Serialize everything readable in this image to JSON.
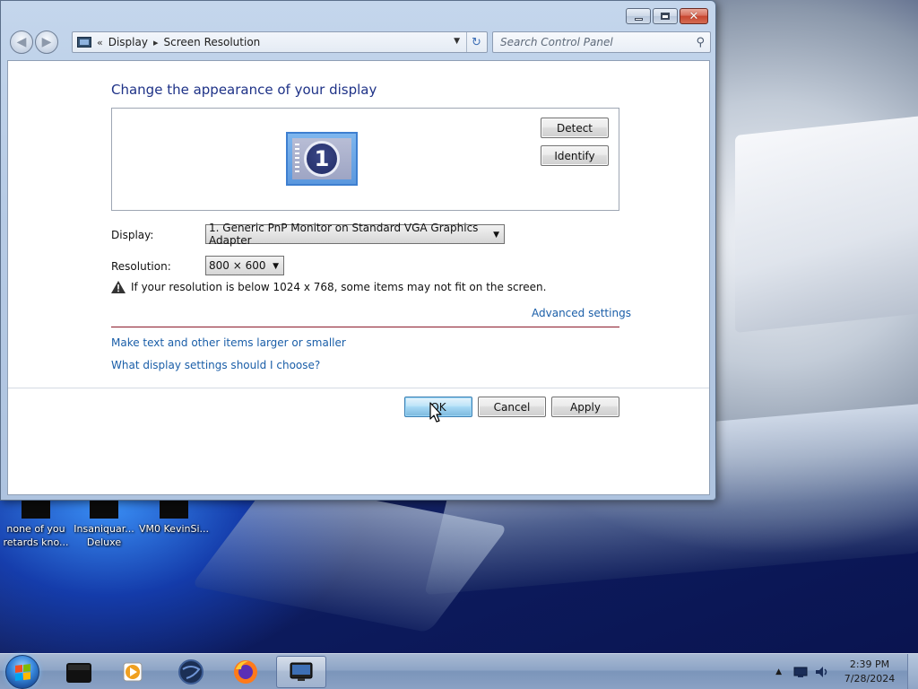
{
  "window": {
    "breadcrumb": [
      "Display",
      "Screen Resolution"
    ],
    "breadcrumb_back": "«",
    "search_placeholder": "Search Control Panel",
    "heading": "Change the appearance of your display",
    "detect_label": "Detect",
    "identify_label": "Identify",
    "monitor_number": "1",
    "display_label": "Display:",
    "display_value": "1. Generic PnP Monitor on Standard VGA Graphics Adapter",
    "resolution_label": "Resolution:",
    "resolution_value": "800 × 600",
    "warning_text": "If your resolution is below 1024 x 768, some items may not fit on the screen.",
    "advanced_settings_link": "Advanced settings",
    "link_text_size": "Make text and other items larger or smaller",
    "link_help": "What display settings should I choose?",
    "ok_label": "OK",
    "cancel_label": "Cancel",
    "apply_label": "Apply"
  },
  "desktop_icons": [
    {
      "label": "none of you retards kno...",
      "icon": "file-icon"
    },
    {
      "label": "Insaniquar... Deluxe",
      "icon": "game-icon"
    },
    {
      "label": "VM0 KevinSi...",
      "icon": "file-icon"
    }
  ],
  "taskbar": {
    "pinned": [
      {
        "name": "terminal",
        "icon": "terminal-icon"
      },
      {
        "name": "media player",
        "icon": "media-player-icon"
      },
      {
        "name": "globe app",
        "icon": "globe-icon"
      },
      {
        "name": "firefox",
        "icon": "firefox-icon"
      },
      {
        "name": "screen resolution",
        "icon": "display-icon",
        "active": true
      }
    ],
    "clock_time": "2:39 PM",
    "clock_date": "7/28/2024"
  },
  "colors": {
    "heading": "#1e3287",
    "link": "#1a5ea8",
    "divider": "#8b1a2a",
    "accent": "#3e7fd0"
  }
}
